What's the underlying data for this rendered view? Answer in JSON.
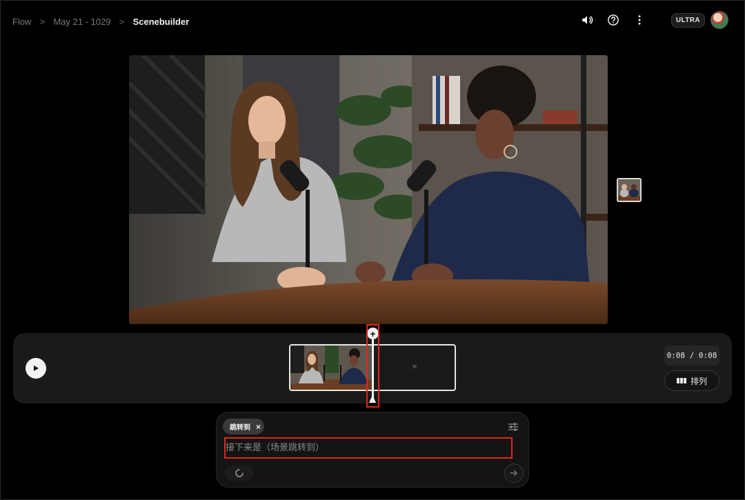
{
  "breadcrumb": {
    "items": [
      "Flow",
      "May 21 - 1029",
      "Scenebuilder"
    ],
    "separator": ">"
  },
  "header": {
    "plan_badge": "ULTRA",
    "icons": [
      "volume-icon",
      "help-icon",
      "more-vert-icon"
    ]
  },
  "timeline": {
    "time_display": "0:08 / 0:08",
    "arrange_label": "排列",
    "empty_slot_glyph": "×",
    "add_glyph": "+"
  },
  "prompt": {
    "chip_label": "跳转到",
    "chip_close": "×",
    "placeholder": "接下来是（场景跳转到）",
    "value": ""
  },
  "colors": {
    "background": "#000000",
    "panel": "#1a1a1a",
    "highlight": "#e0261f",
    "text": "#e8e8e8",
    "muted": "#7a7a7a"
  }
}
